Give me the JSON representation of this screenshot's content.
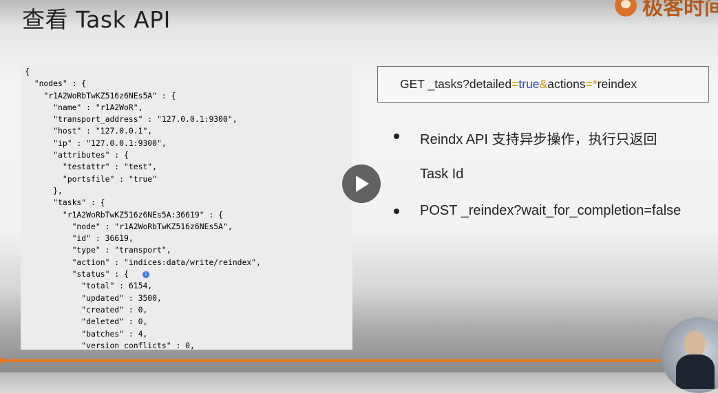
{
  "title": "查看 Task API",
  "logo": {
    "text": "极客时间",
    "icon": "geektime-logo-icon"
  },
  "code_lines": [
    "{",
    "  \"nodes\" : {",
    "    \"r1A2WoRbTwKZ516z6NEs5A\" : {",
    "      \"name\" : \"r1A2WoR\",",
    "      \"transport_address\" : \"127.0.0.1:9300\",",
    "      \"host\" : \"127.0.0.1\",",
    "      \"ip\" : \"127.0.0.1:9300\",",
    "      \"attributes\" : {",
    "        \"testattr\" : \"test\",",
    "        \"portsfile\" : \"true\"",
    "      },",
    "      \"tasks\" : {",
    "        \"r1A2WoRbTwKZ516z6NEs5A:36619\" : {",
    "          \"node\" : \"r1A2WoRbTwKZ516z6NEs5A\",",
    "          \"id\" : 36619,",
    "          \"type\" : \"transport\",",
    "          \"action\" : \"indices:data/write/reindex\",",
    "          \"status\" : {",
    "            \"total\" : 6154,",
    "            \"updated\" : 3500,",
    "            \"created\" : 0,",
    "            \"deleted\" : 0,",
    "            \"batches\" : 4,",
    "            \"version_conflicts\" : 0,"
  ],
  "info_icon_glyph": "i",
  "request": {
    "method_path": "GET _tasks?detailed",
    "eq1": "=",
    "true_val": "true",
    "amp": "&",
    "actions": "actions",
    "eq2": "=",
    "star": "*",
    "reindex": "reindex"
  },
  "bullets": {
    "b1_line1": "Reindx API 支持异步操作，执行只返回",
    "b1_line2": "Task Id",
    "b2": "POST _reindex?wait_for_completion=false"
  },
  "playback": {
    "progress_percent": 100
  },
  "colors": {
    "accent": "#e07a21",
    "code_key": "#2a54b3",
    "code_bg": "#ececec"
  }
}
